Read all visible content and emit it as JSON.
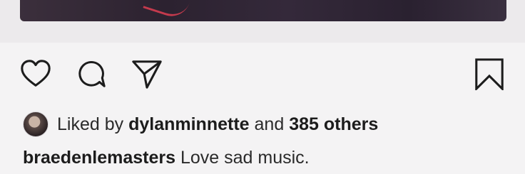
{
  "post": {
    "likes": {
      "prefix": "Liked by",
      "user": "dylanminnette",
      "conjunction": "and",
      "others": "385 others"
    },
    "caption": {
      "username": "braedenlemasters",
      "text": "Love sad music."
    },
    "actions": {
      "like_icon": "heart-icon",
      "comment_icon": "comment-icon",
      "share_icon": "send-icon",
      "save_icon": "bookmark-icon"
    },
    "colors": {
      "background": "#f4f3f4",
      "text": "#1c1c1c",
      "accent_red": "#c43a4d"
    }
  }
}
